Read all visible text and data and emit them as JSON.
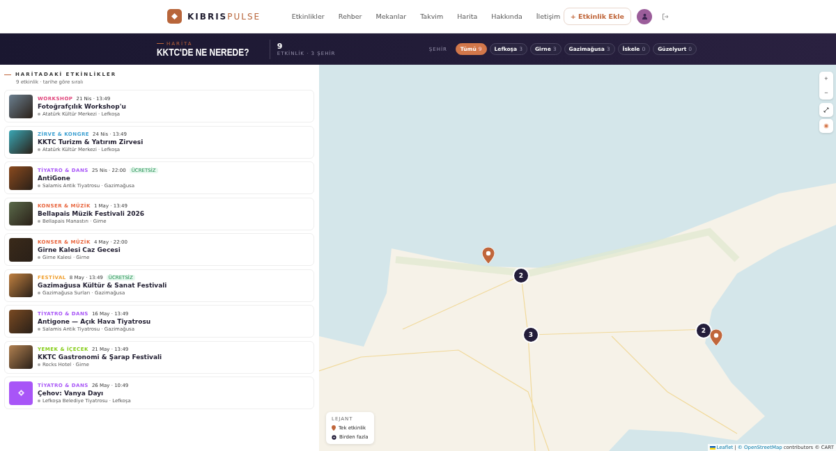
{
  "header": {
    "brand_primary": "KIBRIS",
    "brand_accent": "PULSE",
    "nav": [
      {
        "label": "Etkinlikler",
        "selected": false
      },
      {
        "label": "Rehber",
        "selected": false
      },
      {
        "label": "Mekanlar",
        "selected": false
      },
      {
        "label": "Takvim",
        "selected": false
      },
      {
        "label": "Harita",
        "selected": false
      },
      {
        "label": "Hakkında",
        "selected": false
      },
      {
        "label": "İletişim",
        "selected": false
      }
    ],
    "add_button": "+ Etkinlik Ekle"
  },
  "hero": {
    "eyebrow": "HARİTA",
    "title": "KKTC'DE NE NEREDE?",
    "count": "9",
    "count_caption": "ETKİNLİK · 3 ŞEHİR",
    "filter_label": "ŞEHİR",
    "cities": [
      {
        "label": "Tümü",
        "count": "9",
        "selected": true
      },
      {
        "label": "Lefkoşa",
        "count": "3",
        "selected": false
      },
      {
        "label": "Girne",
        "count": "3",
        "selected": false
      },
      {
        "label": "Gazimağusa",
        "count": "3",
        "selected": false
      },
      {
        "label": "İskele",
        "count": "0",
        "selected": false
      },
      {
        "label": "Güzelyurt",
        "count": "0",
        "selected": false
      }
    ]
  },
  "list": {
    "title": "HARİTADAKİ ETKİNLİKLER",
    "subtitle": "9 etkinlik · tarihe göre sıralı",
    "events": [
      {
        "kind": "photo",
        "category": "WORKSHOP",
        "color": "#e0457b",
        "date": "21 Nis · 13:49",
        "title": "Fotoğrafçılık Workshop'u",
        "venue": "Atatürk Kültür Merkezi · Lefkoşa"
      },
      {
        "kind": "photo",
        "category": "ZİRVE & KONGRE",
        "color": "#3b9fd1",
        "date": "24 Nis · 13:49",
        "title": "KKTC Turizm & Yatırım Zirvesi",
        "venue": "Atatürk Kültür Merkezi · Lefkoşa"
      },
      {
        "kind": "photo",
        "category": "TİYATRO & DANS",
        "color": "#a855f7",
        "date": "25 Nis · 22:00",
        "free": "ÜCRETSİZ",
        "title": "AntiGone",
        "venue": "Salamis Antik Tiyatrosu · Gazimağusa"
      },
      {
        "kind": "photo",
        "category": "KONSER & MÜZİK",
        "color": "#e8643c",
        "date": "1 May · 13:49",
        "title": "Bellapais Müzik Festivali 2026",
        "venue": "Bellapais Manastırı · Girne"
      },
      {
        "kind": "photo",
        "category": "KONSER & MÜZİK",
        "color": "#e8643c",
        "date": "4 May · 22:00",
        "title": "Girne Kalesi Caz Gecesi",
        "venue": "Girne Kalesi · Girne"
      },
      {
        "kind": "photo",
        "category": "FESTİVAL",
        "color": "#f0a030",
        "date": "8 May · 13:49",
        "free": "ÜCRETSİZ",
        "title": "Gazimağusa Kültür & Sanat Festivali",
        "venue": "Gazimağusa Surları · Gazimağusa"
      },
      {
        "kind": "photo",
        "category": "TİYATRO & DANS",
        "color": "#a855f7",
        "date": "16 May · 13:49",
        "title": "Antigone — Açık Hava Tiyatrosu",
        "venue": "Salamis Antik Tiyatrosu · Gazimağusa"
      },
      {
        "kind": "photo",
        "category": "YEMEK & İÇECEK",
        "color": "#84cc16",
        "date": "21 May · 13:49",
        "title": "KKTC Gastronomi & Şarap Festivali",
        "venue": "Rocks Hotel · Girne"
      },
      {
        "kind": "icon",
        "category": "TİYATRO & DANS",
        "color": "#a855f7",
        "date": "26 May · 10:49",
        "title": "Çehov: Vanya Dayı",
        "venue": "Lefkoşa Belediye Tiyatrosu · Lefkoşa"
      }
    ]
  },
  "map": {
    "markers": [
      {
        "kind": "pin"
      },
      {
        "kind": "cluster",
        "count": "2"
      },
      {
        "kind": "cluster",
        "count": "3"
      },
      {
        "kind": "cluster",
        "count": "2"
      },
      {
        "kind": "pin"
      }
    ],
    "zoom_in": "+",
    "zoom_out": "−",
    "legend": {
      "title": "LEJANT",
      "items": [
        {
          "kind": "pin",
          "label": "Tek etkinlik"
        },
        {
          "kind": "cluster",
          "label": "Birden fazla"
        }
      ]
    },
    "attribution": {
      "leaflet": "Leaflet",
      "separator": "|",
      "osm": "© OpenStreetMap",
      "rest": "contributors © CART"
    }
  }
}
